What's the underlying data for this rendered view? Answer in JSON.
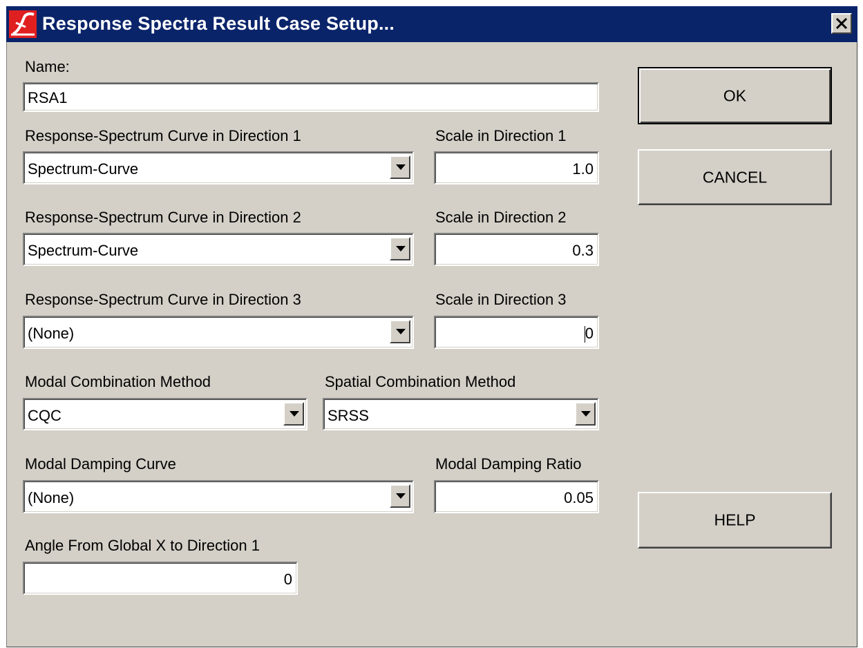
{
  "window": {
    "title": "Response Spectra Result Case Setup...",
    "icon": "app-logo-icon",
    "close_icon": "close-icon"
  },
  "form": {
    "name_label": "Name:",
    "name_value": "RSA1",
    "dir1": {
      "curve_label": "Response-Spectrum Curve in Direction 1",
      "curve_value": "Spectrum-Curve",
      "scale_label": "Scale in Direction 1",
      "scale_value": "1.0"
    },
    "dir2": {
      "curve_label": "Response-Spectrum Curve in Direction 2",
      "curve_value": "Spectrum-Curve",
      "scale_label": "Scale in Direction 2",
      "scale_value": "0.3"
    },
    "dir3": {
      "curve_label": "Response-Spectrum Curve in Direction 3",
      "curve_value": "(None)",
      "scale_label": "Scale in Direction 3",
      "scale_value": "0"
    },
    "modal_combination_label": "Modal Combination Method",
    "modal_combination_value": "CQC",
    "spatial_combination_label": "Spatial Combination Method",
    "spatial_combination_value": "SRSS",
    "damping_curve_label": "Modal Damping Curve",
    "damping_curve_value": "(None)",
    "damping_ratio_label": "Modal Damping Ratio",
    "damping_ratio_value": "0.05",
    "angle_label": "Angle From Global X to Direction 1",
    "angle_value": "0"
  },
  "buttons": {
    "ok": "OK",
    "cancel": "CANCEL",
    "help": "HELP"
  },
  "colors": {
    "titlebar": "#0a246a",
    "dialog_face": "#d4d0c8",
    "logo_red": "#e02020"
  }
}
